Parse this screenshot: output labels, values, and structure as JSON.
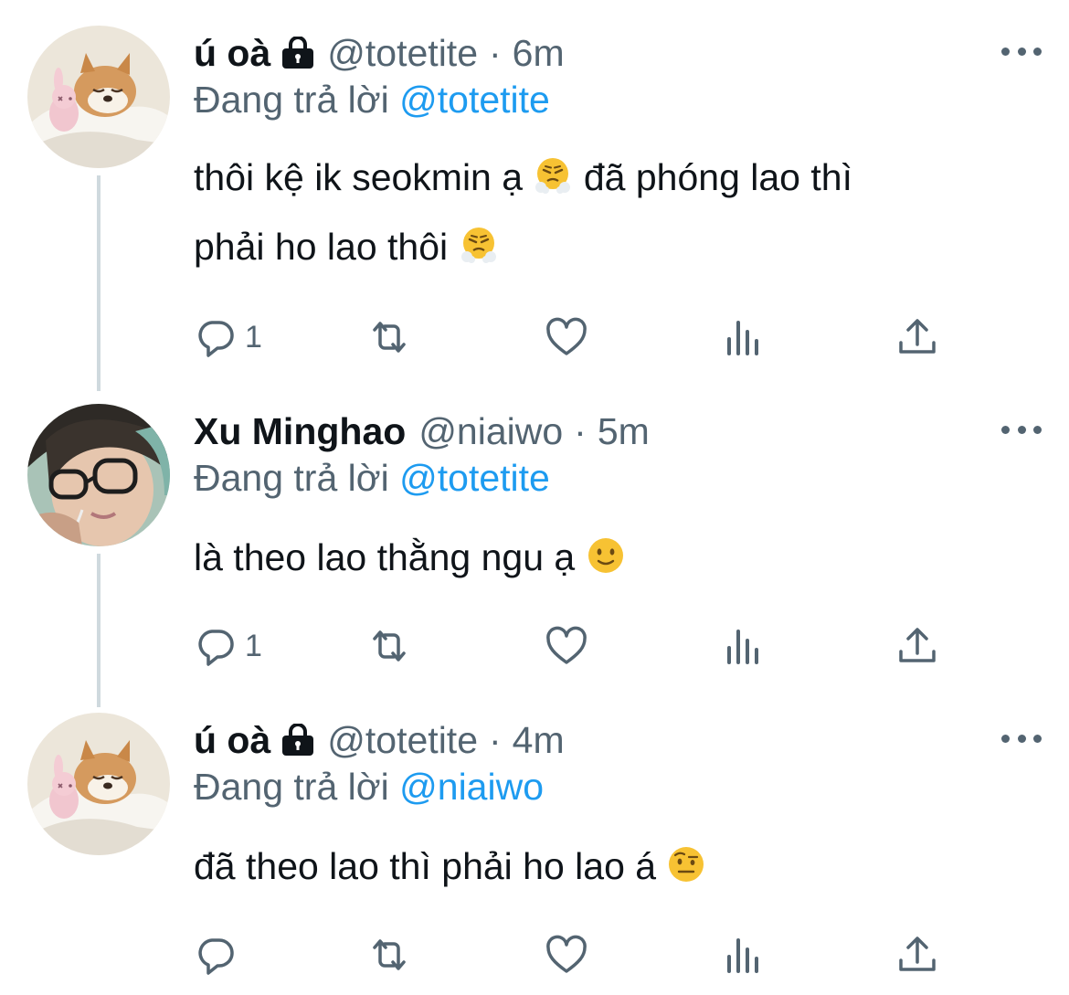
{
  "tweets": [
    {
      "name": "ú oà",
      "handle": "@totetite",
      "dot": "·",
      "time": "6m",
      "replying_prefix": "Đang trả lời ",
      "replying_to": "@totetite",
      "lines": [
        "thôi kệ ik seokmin ạ",
        "đã phóng lao thì",
        "phải ho lao thôi"
      ],
      "reply_count": "1",
      "emoji": "steam-from-nose-emoji"
    },
    {
      "name": "Xu Minghao",
      "handle": "@niaiwo",
      "dot": "·",
      "time": "5m",
      "replying_prefix": "Đang trả lời ",
      "replying_to": "@totetite",
      "lines": [
        "là theo lao thằng ngu ạ"
      ],
      "reply_count": "1",
      "emoji": "slightly-smiling-emoji"
    },
    {
      "name": "ú oà",
      "handle": "@totetite",
      "dot": "·",
      "time": "4m",
      "replying_prefix": "Đang trả lời ",
      "replying_to": "@niaiwo",
      "lines": [
        "đã theo lao thì phải ho lao á"
      ],
      "reply_count": "",
      "emoji": "raised-eyebrow-emoji"
    }
  ],
  "colors": {
    "text": "#0f1419",
    "secondary": "#536471",
    "link": "#1d9bf0",
    "thread_line": "#cfd9de"
  }
}
